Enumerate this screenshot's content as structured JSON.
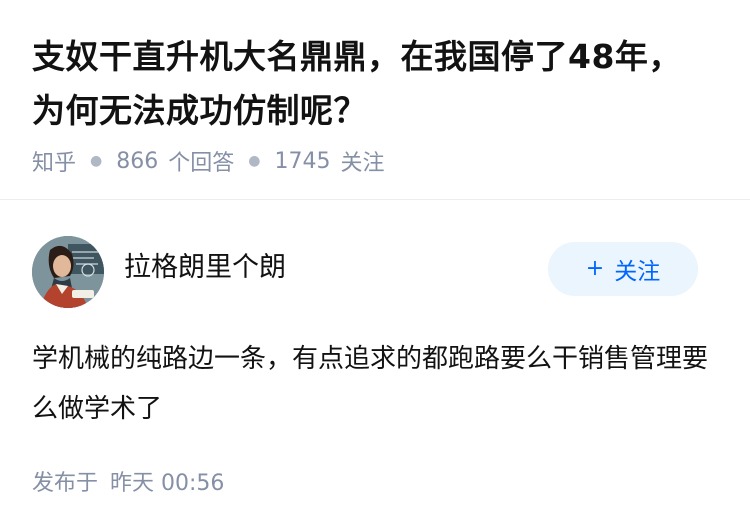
{
  "question": {
    "title": "支奴干直升机大名鼎鼎，在我国停了48年，为何无法成功仿制呢？",
    "source": "知乎",
    "answer_count": "866",
    "answer_label": "个回答",
    "follow_count": "1745",
    "follow_label": "关注"
  },
  "answer": {
    "author_name": "拉格朗里个朗",
    "follow_button": {
      "icon": "plus-icon",
      "label": "关注"
    },
    "content": "学机械的纯路边一条，有点追求的都跑路要么干销售管理要么做学术了",
    "published_label": "发布于",
    "published_time": "昨天 00:56"
  },
  "colors": {
    "title": "#121212",
    "meta": "#8590a6",
    "accent": "#0066ff",
    "follow_bg": "#ebf5fd"
  }
}
